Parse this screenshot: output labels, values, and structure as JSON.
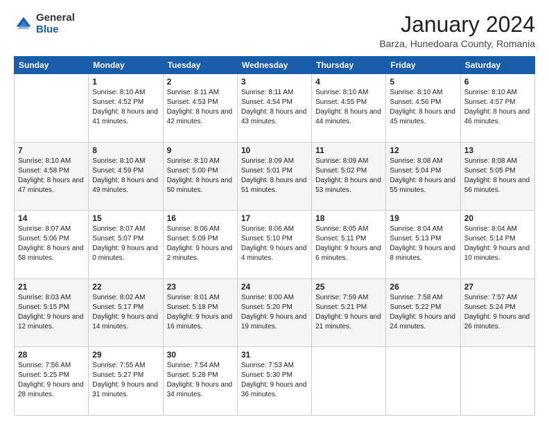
{
  "logo": {
    "general": "General",
    "blue": "Blue"
  },
  "header": {
    "title": "January 2024",
    "subtitle": "Barza, Hunedoara County, Romania"
  },
  "weekdays": [
    "Sunday",
    "Monday",
    "Tuesday",
    "Wednesday",
    "Thursday",
    "Friday",
    "Saturday"
  ],
  "weeks": [
    [
      {
        "day": "",
        "sunrise": "",
        "sunset": "",
        "daylight": ""
      },
      {
        "day": "1",
        "sunrise": "Sunrise: 8:10 AM",
        "sunset": "Sunset: 4:52 PM",
        "daylight": "Daylight: 8 hours and 41 minutes."
      },
      {
        "day": "2",
        "sunrise": "Sunrise: 8:11 AM",
        "sunset": "Sunset: 4:53 PM",
        "daylight": "Daylight: 8 hours and 42 minutes."
      },
      {
        "day": "3",
        "sunrise": "Sunrise: 8:11 AM",
        "sunset": "Sunset: 4:54 PM",
        "daylight": "Daylight: 8 hours and 43 minutes."
      },
      {
        "day": "4",
        "sunrise": "Sunrise: 8:10 AM",
        "sunset": "Sunset: 4:55 PM",
        "daylight": "Daylight: 8 hours and 44 minutes."
      },
      {
        "day": "5",
        "sunrise": "Sunrise: 8:10 AM",
        "sunset": "Sunset: 4:56 PM",
        "daylight": "Daylight: 8 hours and 45 minutes."
      },
      {
        "day": "6",
        "sunrise": "Sunrise: 8:10 AM",
        "sunset": "Sunset: 4:57 PM",
        "daylight": "Daylight: 8 hours and 46 minutes."
      }
    ],
    [
      {
        "day": "7",
        "sunrise": "Sunrise: 8:10 AM",
        "sunset": "Sunset: 4:58 PM",
        "daylight": "Daylight: 8 hours and 47 minutes."
      },
      {
        "day": "8",
        "sunrise": "Sunrise: 8:10 AM",
        "sunset": "Sunset: 4:59 PM",
        "daylight": "Daylight: 8 hours and 49 minutes."
      },
      {
        "day": "9",
        "sunrise": "Sunrise: 8:10 AM",
        "sunset": "Sunset: 5:00 PM",
        "daylight": "Daylight: 8 hours and 50 minutes."
      },
      {
        "day": "10",
        "sunrise": "Sunrise: 8:09 AM",
        "sunset": "Sunset: 5:01 PM",
        "daylight": "Daylight: 8 hours and 51 minutes."
      },
      {
        "day": "11",
        "sunrise": "Sunrise: 8:09 AM",
        "sunset": "Sunset: 5:02 PM",
        "daylight": "Daylight: 8 hours and 53 minutes."
      },
      {
        "day": "12",
        "sunrise": "Sunrise: 8:08 AM",
        "sunset": "Sunset: 5:04 PM",
        "daylight": "Daylight: 8 hours and 55 minutes."
      },
      {
        "day": "13",
        "sunrise": "Sunrise: 8:08 AM",
        "sunset": "Sunset: 5:05 PM",
        "daylight": "Daylight: 8 hours and 56 minutes."
      }
    ],
    [
      {
        "day": "14",
        "sunrise": "Sunrise: 8:07 AM",
        "sunset": "Sunset: 5:06 PM",
        "daylight": "Daylight: 8 hours and 58 minutes."
      },
      {
        "day": "15",
        "sunrise": "Sunrise: 8:07 AM",
        "sunset": "Sunset: 5:07 PM",
        "daylight": "Daylight: 9 hours and 0 minutes."
      },
      {
        "day": "16",
        "sunrise": "Sunrise: 8:06 AM",
        "sunset": "Sunset: 5:09 PM",
        "daylight": "Daylight: 9 hours and 2 minutes."
      },
      {
        "day": "17",
        "sunrise": "Sunrise: 8:06 AM",
        "sunset": "Sunset: 5:10 PM",
        "daylight": "Daylight: 9 hours and 4 minutes."
      },
      {
        "day": "18",
        "sunrise": "Sunrise: 8:05 AM",
        "sunset": "Sunset: 5:11 PM",
        "daylight": "Daylight: 9 hours and 6 minutes."
      },
      {
        "day": "19",
        "sunrise": "Sunrise: 8:04 AM",
        "sunset": "Sunset: 5:13 PM",
        "daylight": "Daylight: 9 hours and 8 minutes."
      },
      {
        "day": "20",
        "sunrise": "Sunrise: 8:04 AM",
        "sunset": "Sunset: 5:14 PM",
        "daylight": "Daylight: 9 hours and 10 minutes."
      }
    ],
    [
      {
        "day": "21",
        "sunrise": "Sunrise: 8:03 AM",
        "sunset": "Sunset: 5:15 PM",
        "daylight": "Daylight: 9 hours and 12 minutes."
      },
      {
        "day": "22",
        "sunrise": "Sunrise: 8:02 AM",
        "sunset": "Sunset: 5:17 PM",
        "daylight": "Daylight: 9 hours and 14 minutes."
      },
      {
        "day": "23",
        "sunrise": "Sunrise: 8:01 AM",
        "sunset": "Sunset: 5:18 PM",
        "daylight": "Daylight: 9 hours and 16 minutes."
      },
      {
        "day": "24",
        "sunrise": "Sunrise: 8:00 AM",
        "sunset": "Sunset: 5:20 PM",
        "daylight": "Daylight: 9 hours and 19 minutes."
      },
      {
        "day": "25",
        "sunrise": "Sunrise: 7:59 AM",
        "sunset": "Sunset: 5:21 PM",
        "daylight": "Daylight: 9 hours and 21 minutes."
      },
      {
        "day": "26",
        "sunrise": "Sunrise: 7:58 AM",
        "sunset": "Sunset: 5:22 PM",
        "daylight": "Daylight: 9 hours and 24 minutes."
      },
      {
        "day": "27",
        "sunrise": "Sunrise: 7:57 AM",
        "sunset": "Sunset: 5:24 PM",
        "daylight": "Daylight: 9 hours and 26 minutes."
      }
    ],
    [
      {
        "day": "28",
        "sunrise": "Sunrise: 7:56 AM",
        "sunset": "Sunset: 5:25 PM",
        "daylight": "Daylight: 9 hours and 28 minutes."
      },
      {
        "day": "29",
        "sunrise": "Sunrise: 7:55 AM",
        "sunset": "Sunset: 5:27 PM",
        "daylight": "Daylight: 9 hours and 31 minutes."
      },
      {
        "day": "30",
        "sunrise": "Sunrise: 7:54 AM",
        "sunset": "Sunset: 5:28 PM",
        "daylight": "Daylight: 9 hours and 34 minutes."
      },
      {
        "day": "31",
        "sunrise": "Sunrise: 7:53 AM",
        "sunset": "Sunset: 5:30 PM",
        "daylight": "Daylight: 9 hours and 36 minutes."
      },
      {
        "day": "",
        "sunrise": "",
        "sunset": "",
        "daylight": ""
      },
      {
        "day": "",
        "sunrise": "",
        "sunset": "",
        "daylight": ""
      },
      {
        "day": "",
        "sunrise": "",
        "sunset": "",
        "daylight": ""
      }
    ]
  ]
}
